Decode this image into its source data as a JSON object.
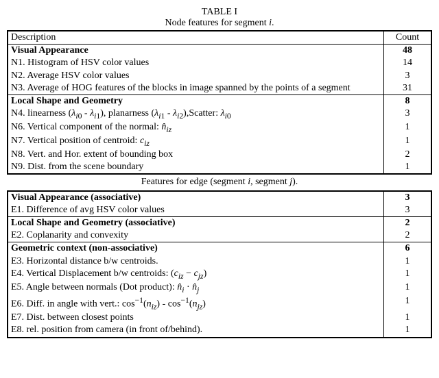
{
  "table_label": "TABLE I",
  "caption1": "Node features for segment i.",
  "headers": {
    "desc": "Description",
    "count": "Count"
  },
  "node_groups": [
    {
      "title": "Visual Appearance",
      "count": "48",
      "rows": [
        {
          "desc": "N1. Histogram of HSV color values",
          "count": "14"
        },
        {
          "desc": "N2. Average HSV color values",
          "count": "3"
        },
        {
          "desc": "N3. Average of HOG features of the blocks in image spanned by the points of a segment",
          "count": "31"
        }
      ]
    },
    {
      "title": "Local Shape and Geometry",
      "count": "8",
      "rows": [
        {
          "desc": "N4. linearness (λ_i0 - λ_i1), planarness (λ_i1 - λ_i2),Scatter: λ_i0",
          "count": "3"
        },
        {
          "desc": "N6. Vertical component of the normal: n̂_iz",
          "count": "1"
        },
        {
          "desc": "N7. Vertical position of centroid: c_iz",
          "count": "1"
        },
        {
          "desc": "N8. Vert. and Hor. extent of bounding box",
          "count": "2"
        },
        {
          "desc": "N9. Dist. from the scene boundary",
          "count": "1"
        }
      ]
    }
  ],
  "caption2": "Features for edge (segment i, segment j).",
  "edge_groups": [
    {
      "title": "Visual Appearance (associative)",
      "count": "3",
      "rows": [
        {
          "desc": "E1. Difference of avg HSV color values",
          "count": "3"
        }
      ]
    },
    {
      "title": "Local Shape and Geometry (associative)",
      "count": "2",
      "rows": [
        {
          "desc": "E2. Coplanarity and convexity",
          "count": "2"
        }
      ]
    },
    {
      "title": "Geometric context (non-associative)",
      "count": "6",
      "rows": [
        {
          "desc": "E3. Horizontal distance b/w centroids.",
          "count": "1"
        },
        {
          "desc": "E4. Vertical Displacement b/w centroids: (c_iz − c_jz)",
          "count": "1"
        },
        {
          "desc": "E5. Angle between normals (Dot product): n̂_i · n̂_j",
          "count": "1"
        },
        {
          "desc": "E6. Diff. in angle with vert.: cos⁻¹(n_iz) - cos⁻¹(n_jz)",
          "count": "1"
        },
        {
          "desc": "E7. Dist. between closest points",
          "count": "1"
        },
        {
          "desc": "E8. rel. position from camera (in front of/behind).",
          "count": "1"
        }
      ]
    }
  ]
}
